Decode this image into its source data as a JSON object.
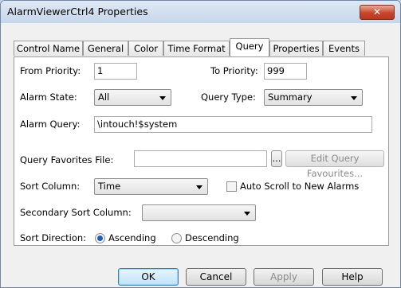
{
  "window": {
    "title": "AlarmViewerCtrl4 Properties",
    "close_glyph": "✕"
  },
  "tabs": [
    {
      "label": "Control Name"
    },
    {
      "label": "General"
    },
    {
      "label": "Color"
    },
    {
      "label": "Time Format"
    },
    {
      "label": "Query",
      "active": true
    },
    {
      "label": "Properties"
    },
    {
      "label": "Events"
    }
  ],
  "query": {
    "from_priority_label": "From Priority:",
    "from_priority_value": "1",
    "to_priority_label": "To Priority:",
    "to_priority_value": "999",
    "alarm_state_label": "Alarm State:",
    "alarm_state_value": "All",
    "query_type_label": "Query Type:",
    "query_type_value": "Summary",
    "alarm_query_label": "Alarm Query:",
    "alarm_query_value": "\\intouch!$system",
    "favorites_label": "Query Favorites File:",
    "favorites_value": "",
    "browse_label": "...",
    "edit_favorites_label": "Edit Query Favourites...",
    "sort_column_label": "Sort Column:",
    "sort_column_value": "Time",
    "auto_scroll_label": "Auto Scroll to New Alarms",
    "auto_scroll_checked": false,
    "secondary_sort_label": "Secondary Sort Column:",
    "secondary_sort_value": "",
    "sort_direction_label": "Sort Direction:",
    "ascending_label": "Ascending",
    "descending_label": "Descending",
    "sort_direction_selected": "Ascending"
  },
  "buttons": {
    "ok": "OK",
    "cancel": "Cancel",
    "apply": "Apply",
    "help": "Help"
  }
}
